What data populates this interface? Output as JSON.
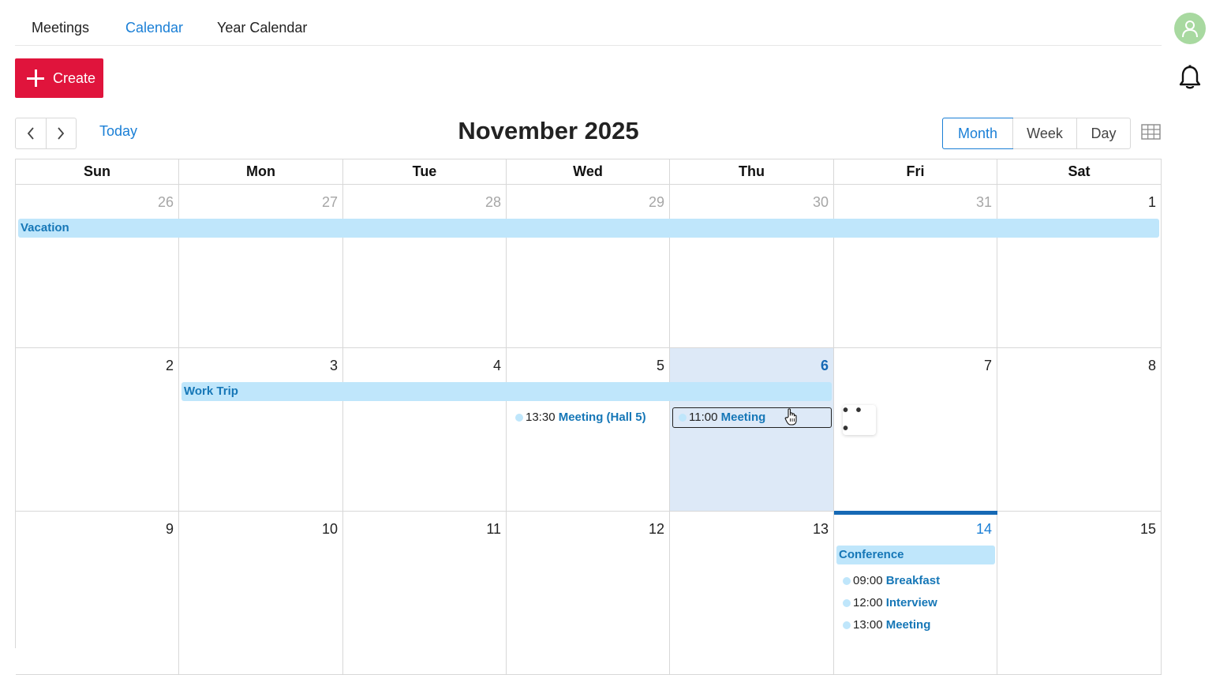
{
  "tabs": [
    {
      "label": "Meetings",
      "active": false
    },
    {
      "label": "Calendar",
      "active": true
    },
    {
      "label": "Year Calendar",
      "active": false
    }
  ],
  "header": {
    "avatar_icon": "user-icon",
    "notification_icon": "bell-icon"
  },
  "toolbar": {
    "create_label": "Create",
    "prev_icon": "chevron-left-icon",
    "next_icon": "chevron-right-icon",
    "today_label": "Today",
    "title": "November 2025",
    "views": [
      {
        "label": "Month",
        "active": true
      },
      {
        "label": "Week",
        "active": false
      },
      {
        "label": "Day",
        "active": false
      }
    ],
    "grid_icon": "table-grid-icon"
  },
  "calendar": {
    "weekdays": [
      "Sun",
      "Mon",
      "Tue",
      "Wed",
      "Thu",
      "Fri",
      "Sat"
    ],
    "weeks": [
      {
        "days": [
          {
            "num": "26",
            "state": "other-month"
          },
          {
            "num": "27",
            "state": "other-month"
          },
          {
            "num": "28",
            "state": "other-month"
          },
          {
            "num": "29",
            "state": "other-month"
          },
          {
            "num": "30",
            "state": "other-month"
          },
          {
            "num": "31",
            "state": "other-month"
          },
          {
            "num": "1",
            "state": "normal"
          }
        ],
        "allday": [
          {
            "label": "Vacation",
            "start": 0,
            "end": 6
          }
        ],
        "events": []
      },
      {
        "days": [
          {
            "num": "2",
            "state": "normal"
          },
          {
            "num": "3",
            "state": "normal"
          },
          {
            "num": "4",
            "state": "normal"
          },
          {
            "num": "5",
            "state": "normal"
          },
          {
            "num": "6",
            "state": "selected"
          },
          {
            "num": "7",
            "state": "normal"
          },
          {
            "num": "8",
            "state": "normal"
          }
        ],
        "allday": [
          {
            "label": "Work Trip",
            "start": 1,
            "end": 4
          }
        ],
        "events": [
          {
            "day": 3,
            "time": "13:30",
            "name": "Meeting (Hall 5)",
            "focused": false
          },
          {
            "day": 4,
            "time": "11:00",
            "name": "Meeting",
            "focused": true
          }
        ],
        "more_label": "• • •"
      },
      {
        "days": [
          {
            "num": "9",
            "state": "normal"
          },
          {
            "num": "10",
            "state": "normal"
          },
          {
            "num": "11",
            "state": "normal"
          },
          {
            "num": "12",
            "state": "normal"
          },
          {
            "num": "13",
            "state": "normal"
          },
          {
            "num": "14",
            "state": "today"
          },
          {
            "num": "15",
            "state": "normal"
          }
        ],
        "allday": [
          {
            "label": "Conference",
            "start": 5,
            "end": 5
          }
        ],
        "events": [
          {
            "day": 5,
            "time": "09:00",
            "name": "Breakfast",
            "focused": false
          },
          {
            "day": 5,
            "time": "12:00",
            "name": "Interview",
            "focused": false
          },
          {
            "day": 5,
            "time": "13:00",
            "name": "Meeting",
            "focused": false
          }
        ]
      }
    ]
  },
  "colors": {
    "accent": "#1a7fd6",
    "create": "#e0143c",
    "event_bg": "#bfe6fb",
    "event_text": "#1677b7",
    "selected_day": "#dde9f7",
    "today_bar": "#1669b5"
  }
}
